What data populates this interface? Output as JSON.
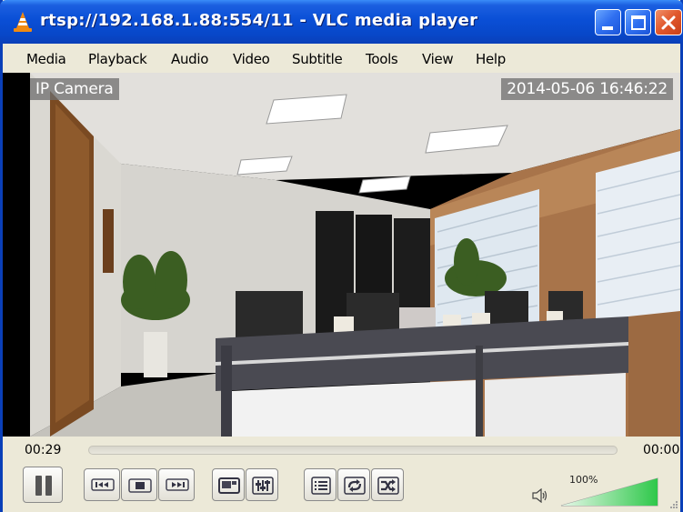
{
  "window": {
    "title": "rtsp://192.168.1.88:554/11 - VLC media player"
  },
  "menu": [
    "Media",
    "Playback",
    "Audio",
    "Video",
    "Subtitle",
    "Tools",
    "View",
    "Help"
  ],
  "video": {
    "osd_camera_name": "IP Camera",
    "osd_timestamp": "2014-05-06 16:46:22"
  },
  "seek": {
    "elapsed": "00:29",
    "total": "00:00",
    "progress": 0.0
  },
  "controls": {
    "buttons": [
      "pause-icon",
      "previous-icon",
      "stop-icon",
      "next-icon",
      "fullscreen-icon",
      "extended-settings-icon",
      "playlist-icon",
      "loop-icon",
      "shuffle-icon"
    ]
  },
  "volume": {
    "label": "100%",
    "level": 1.0
  },
  "colors": {
    "titlebar": "#0a4fd6",
    "volume_fill": "#2ec84a",
    "chrome": "#ece9d8"
  }
}
